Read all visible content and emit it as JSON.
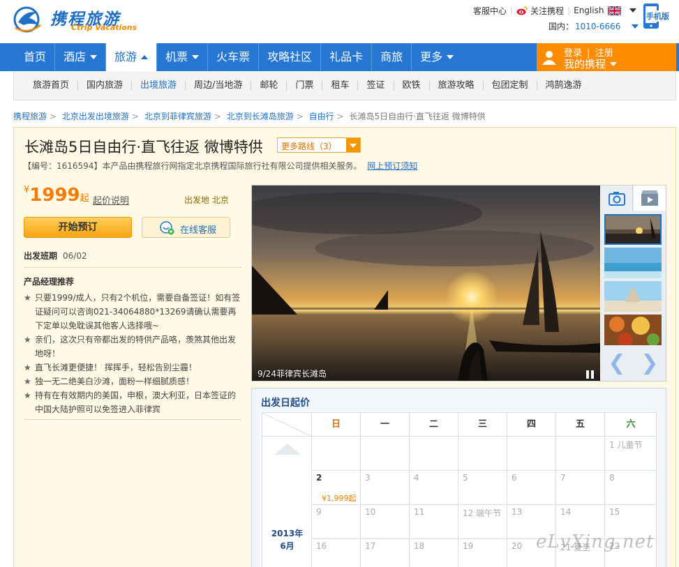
{
  "header": {
    "logo_cn": "携程旅游",
    "logo_en": "Ctrip Vacations",
    "service_center": "客服中心",
    "follow_ctrip": "关注携程",
    "language": "English",
    "domestic_label": "国内：",
    "hotline": "1010-6666",
    "mobile_label": "手机版"
  },
  "nav": {
    "items": [
      {
        "label": "首页"
      },
      {
        "label": "酒店"
      },
      {
        "label": "旅游"
      },
      {
        "label": "机票"
      },
      {
        "label": "火车票"
      },
      {
        "label": "攻略社区"
      },
      {
        "label": "礼品卡"
      },
      {
        "label": "商旅"
      },
      {
        "label": "更多"
      }
    ],
    "login": "登录",
    "sep": "|",
    "register": "注册",
    "my_ctrip": "我的携程"
  },
  "subnav": {
    "items": [
      {
        "label": "旅游首页"
      },
      {
        "label": "国内旅游"
      },
      {
        "label": "出境旅游"
      },
      {
        "label": "周边/当地游"
      },
      {
        "label": "邮轮"
      },
      {
        "label": "门票"
      },
      {
        "label": "租车"
      },
      {
        "label": "签证"
      },
      {
        "label": "欧铁"
      },
      {
        "label": "旅游攻略"
      },
      {
        "label": "包团定制"
      },
      {
        "label": "鸿鹄逸游"
      }
    ]
  },
  "breadcrumb": {
    "items": [
      "携程旅游",
      "北京出发出境旅游",
      "北京到菲律宾旅游",
      "北京到长滩岛旅游",
      "自由行"
    ],
    "current": "长滩岛5日自由行·直飞往返 微博特供",
    "sep": ">"
  },
  "product": {
    "title": "长滩岛5日自由行·直飞往返 微博特供",
    "more_routes": "更多路线（3）",
    "info": "【编号：1616594】本产品由携程旅行网指定北京携程国际旅行社有限公司提供相关服务。",
    "info_link": "网上预订须知",
    "currency": "¥",
    "price": "1999",
    "price_suffix": "起",
    "price_note": "起价说明",
    "depart_label": "出发地",
    "depart_city": "北京",
    "book_button": "开始预订",
    "service_button": "在线客服",
    "dates_label": "出发班期",
    "dates_value": "06/02",
    "rec_title": "产品经理推荐",
    "star": "★",
    "recommendations": [
      "只要1999/成人，只有2个机位，需要自备签证！如有签证疑问可以咨询021-34064880*13269请确认需要再下定单以免耽误其他客人选择哦~",
      "亲们，这次只有帝都出发的特供产品咯，羡煞其他出发地呀！",
      "直飞长滩更便捷！ 挥挥手，轻松告别尘霾！",
      "独一无二绝美白沙滩，面粉一样细腻质感！",
      "持有在有效期内的美国，申根，澳大利亚，日本签证的中国大陆护照可以免签进入菲律宾"
    ]
  },
  "gallery": {
    "caption": "9/24菲律宾长滩岛",
    "prev": "❮",
    "next": "❯"
  },
  "calendar": {
    "title": "出发日起价",
    "weekdays": [
      "日",
      "一",
      "二",
      "三",
      "四",
      "五",
      "六"
    ],
    "year": "2013年",
    "month": "6月",
    "weeks": [
      [
        "",
        "",
        "",
        "",
        "",
        "",
        "1 儿童节"
      ],
      [
        "2",
        "3",
        "4",
        "5",
        "6",
        "7",
        "8"
      ],
      [
        "9",
        "10",
        "11",
        "12 端午节",
        "13",
        "14",
        "15"
      ],
      [
        "16",
        "17",
        "18",
        "19",
        "20",
        "21 夏至",
        "22"
      ]
    ],
    "price_on_2": "¥1,999起"
  },
  "watermark": "eLvXing.net",
  "colors": {
    "brand_blue": "#2577d3",
    "accent_orange": "#ff8c00",
    "price_orange": "#f27c00"
  }
}
